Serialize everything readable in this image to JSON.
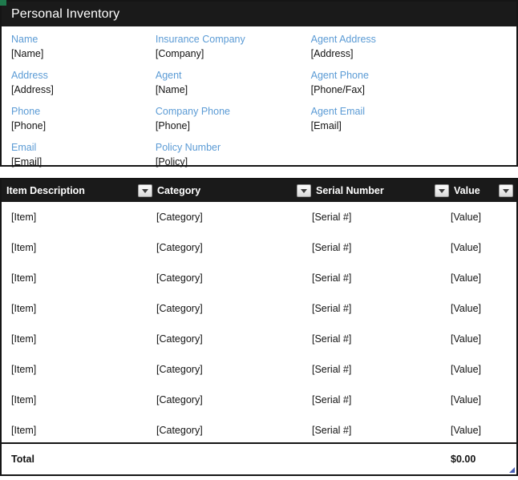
{
  "document": {
    "title": "Personal Inventory",
    "corner_marker_color": "#1f7a4d",
    "header_bg": "#1a1a1a",
    "label_color": "#5B9BD5",
    "border_color": "#151515"
  },
  "info_panel": {
    "columns": [
      {
        "fields": [
          {
            "label": "Name",
            "value": "[Name]"
          },
          {
            "label": "Address",
            "value": "[Address]"
          },
          {
            "label": "Phone",
            "value": "[Phone]"
          },
          {
            "label": "Email",
            "value": "[Email]"
          }
        ]
      },
      {
        "fields": [
          {
            "label": "Insurance Company",
            "value": "[Company]"
          },
          {
            "label": "Agent",
            "value": "[Name]"
          },
          {
            "label": "Company Phone",
            "value": "[Phone]"
          },
          {
            "label": "Policy Number",
            "value": "[Policy]"
          }
        ]
      },
      {
        "fields": [
          {
            "label": "Agent Address",
            "value": "[Address]"
          },
          {
            "label": "Agent Phone",
            "value": "[Phone/Fax]"
          },
          {
            "label": "Agent Email",
            "value": "[Email]"
          }
        ]
      }
    ]
  },
  "inventory_table": {
    "columns": [
      {
        "label": "Item Description",
        "has_filter": false
      },
      {
        "label": "Category",
        "has_filter": true
      },
      {
        "label": "Serial Number",
        "has_filter": true
      },
      {
        "label": "Value",
        "has_filter": true
      },
      {
        "label": "",
        "has_filter": true
      }
    ],
    "header_filter_icon": "filter-dropdown-icon",
    "rows": [
      {
        "description": "[Item]",
        "category": "[Category]",
        "serial": "[Serial #]",
        "value": "[Value]"
      },
      {
        "description": "[Item]",
        "category": "[Category]",
        "serial": "[Serial #]",
        "value": "[Value]"
      },
      {
        "description": "[Item]",
        "category": "[Category]",
        "serial": "[Serial #]",
        "value": "[Value]"
      },
      {
        "description": "[Item]",
        "category": "[Category]",
        "serial": "[Serial #]",
        "value": "[Value]"
      },
      {
        "description": "[Item]",
        "category": "[Category]",
        "serial": "[Serial #]",
        "value": "[Value]"
      },
      {
        "description": "[Item]",
        "category": "[Category]",
        "serial": "[Serial #]",
        "value": "[Value]"
      },
      {
        "description": "[Item]",
        "category": "[Category]",
        "serial": "[Serial #]",
        "value": "[Value]"
      },
      {
        "description": "[Item]",
        "category": "[Category]",
        "serial": "[Serial #]",
        "value": "[Value]"
      }
    ],
    "total": {
      "label": "Total",
      "value": "$0.00"
    }
  }
}
